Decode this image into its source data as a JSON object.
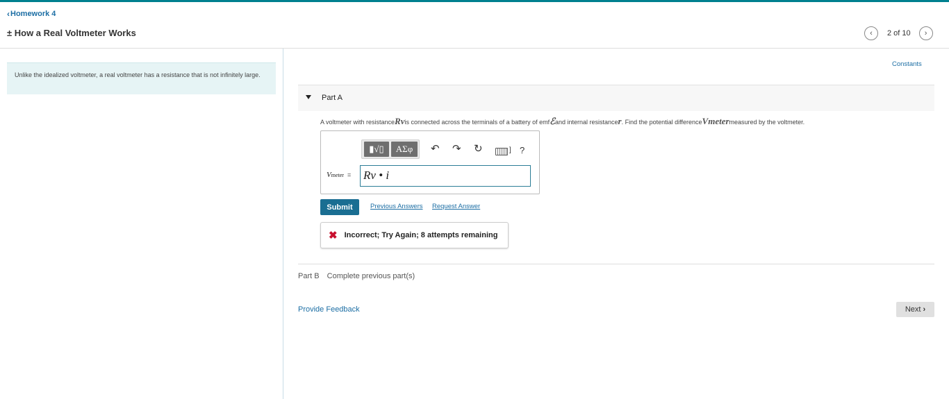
{
  "header": {
    "back_label": "Homework 4",
    "title": "± How a Real Voltmeter Works",
    "pager": {
      "count": "2 of 10"
    }
  },
  "sidebar": {
    "intro": "Unlike the idealized voltmeter, a real voltmeter has a resistance that is not infinitely large."
  },
  "main": {
    "constants_label": "Constants",
    "part_a": {
      "label": "Part A",
      "question_parts": [
        "A voltmeter with resistance ",
        "Rv",
        " is connected across the terminals of a battery of emf ",
        "ℰ",
        " and internal resistance ",
        "r",
        ". Find the potential difference ",
        "Vmeter",
        " measured by the voltmeter."
      ],
      "toolbar": {
        "templates_label": "▮√▯",
        "symbols_label": "ΑΣφ",
        "help_label": "?"
      },
      "lhs_var": "V",
      "lhs_sub": "meter",
      "lhs_eq": "=",
      "answer_value": "Rv • i",
      "submit_label": "Submit",
      "previous_answers_label": "Previous Answers",
      "request_answer_label": "Request Answer",
      "feedback_message": "Incorrect; Try Again; 8 attempts remaining"
    },
    "part_b": {
      "label": "Part B",
      "status": "Complete previous part(s)"
    },
    "provide_feedback_label": "Provide Feedback",
    "next_label": "Next"
  },
  "icons": {
    "back": "chevron-left-icon",
    "prev_page": "chevron-left-icon",
    "next_page": "chevron-right-icon",
    "collapse": "triangle-down-icon",
    "undo": "undo-icon",
    "redo": "redo-icon",
    "reset": "reset-icon",
    "keyboard": "keyboard-icon",
    "incorrect": "x-mark-icon"
  },
  "colors": {
    "accent": "#00808f",
    "link": "#1c6ea4",
    "submit": "#1a6e92",
    "error": "#c8102e",
    "intro_bg": "#e6f4f5"
  }
}
